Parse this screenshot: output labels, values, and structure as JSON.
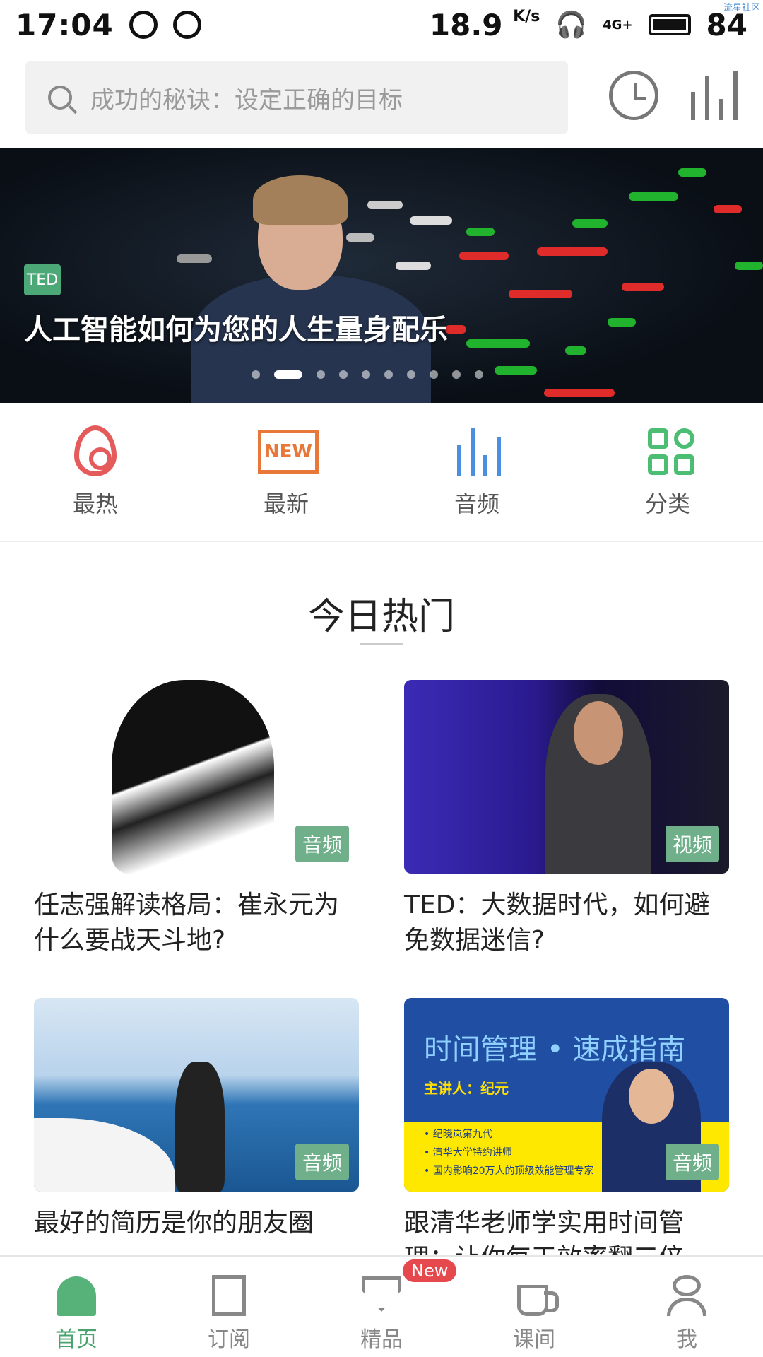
{
  "status": {
    "time": "17:04",
    "speed": "18.9",
    "speed_unit": "K/s",
    "signal": "4G+",
    "battery": "84"
  },
  "watermark": "流星社区",
  "search": {
    "placeholder": "成功的秘诀：设定正确的目标"
  },
  "banner": {
    "badge": "TED",
    "title": "人工智能如何为您的人生量身配乐",
    "slides": 10,
    "active_slide": 2
  },
  "categories": [
    {
      "label": "最热",
      "icon": "flame-icon"
    },
    {
      "label": "最新",
      "icon": "new-icon",
      "icon_text": "NEW"
    },
    {
      "label": "音频",
      "icon": "audio-bars-icon"
    },
    {
      "label": "分类",
      "icon": "category-grid-icon"
    }
  ],
  "section": {
    "title": "今日热门"
  },
  "cards": [
    {
      "tag": "音频",
      "caption": "任志强解读格局：崔永元为什么要战天斗地?"
    },
    {
      "tag": "视频",
      "caption": "TED：大数据时代，如何避免数据迷信?"
    },
    {
      "tag": "音频",
      "caption": "最好的简历是你的朋友圈"
    },
    {
      "tag": "音频",
      "caption": "跟清华老师学实用时间管理：让你每天效率翻三倍",
      "image_text": {
        "title_a": "时间管理",
        "title_b": "• 速成指南",
        "speaker": "主讲人：纪元",
        "bullets": [
          "• 纪晓岚第九代",
          "• 清华大学特约讲师",
          "• 国内影响20万人的顶级效能管理专家"
        ]
      }
    }
  ],
  "tabs": [
    {
      "label": "首页",
      "icon": "home-icon",
      "active": true
    },
    {
      "label": "订阅",
      "icon": "bookmark-icon"
    },
    {
      "label": "精品",
      "icon": "gem-icon",
      "badge": "New"
    },
    {
      "label": "课间",
      "icon": "coffee-cup-icon"
    },
    {
      "label": "我",
      "icon": "person-icon"
    }
  ],
  "colors": {
    "accent": "#57b27a",
    "tag_bg": "#6fb08a",
    "badge_red": "#e5484d",
    "new_orange": "#e8783a",
    "audio_blue": "#4a8fe0",
    "flame_red": "#e55a5a"
  }
}
